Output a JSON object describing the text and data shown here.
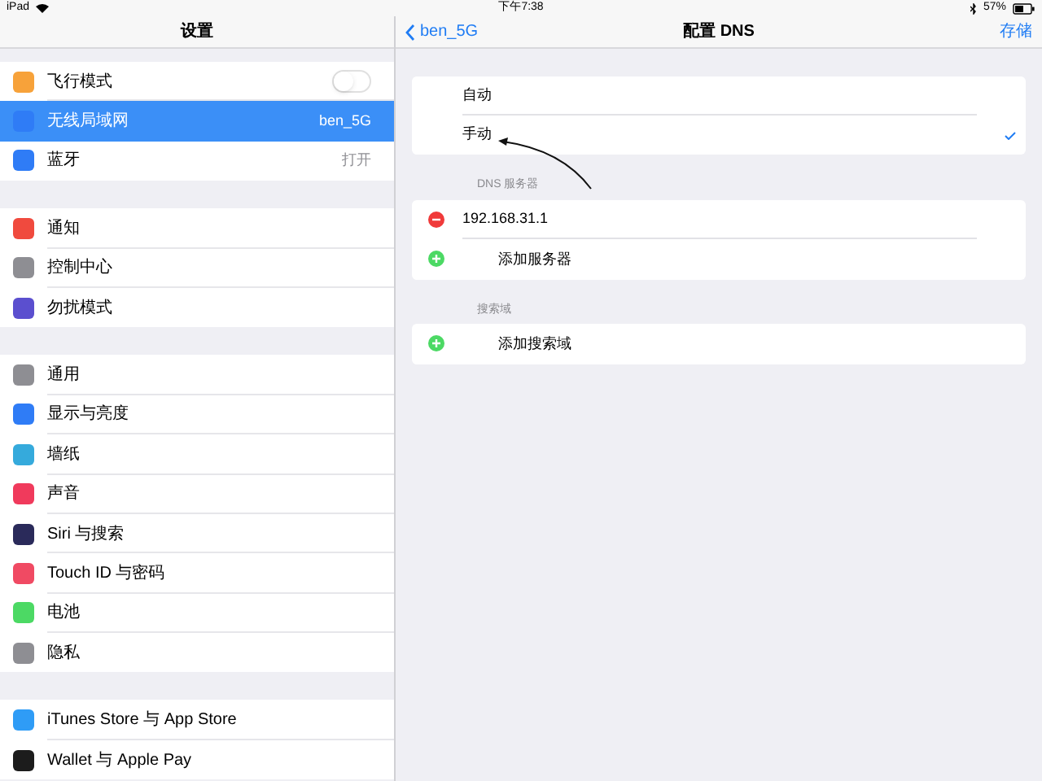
{
  "status_bar": {
    "device": "iPad",
    "time": "下午7:38",
    "battery": "57%"
  },
  "sidebar": {
    "title": "设置",
    "groups": [
      [
        {
          "label": "飞行模式",
          "color": "#f7a23a",
          "selected": false,
          "kind": "toggle",
          "on": false
        },
        {
          "label": "无线局域网",
          "color": "#2f7cf6",
          "selected": true,
          "kind": "value",
          "value": "ben_5G"
        },
        {
          "label": "蓝牙",
          "color": "#2f7cf6",
          "selected": false,
          "kind": "value",
          "value": "打开"
        }
      ],
      [
        {
          "label": "通知",
          "color": "#f04a3e",
          "selected": false,
          "kind": "plain"
        },
        {
          "label": "控制中心",
          "color": "#8e8e93",
          "selected": false,
          "kind": "plain"
        },
        {
          "label": "勿扰模式",
          "color": "#5b4fcf",
          "selected": false,
          "kind": "plain"
        }
      ],
      [
        {
          "label": "通用",
          "color": "#8e8e93",
          "selected": false,
          "kind": "plain"
        },
        {
          "label": "显示与亮度",
          "color": "#2f7cf6",
          "selected": false,
          "kind": "plain"
        },
        {
          "label": "墙纸",
          "color": "#35aadc",
          "selected": false,
          "kind": "plain"
        },
        {
          "label": "声音",
          "color": "#f03a5c",
          "selected": false,
          "kind": "plain"
        },
        {
          "label": "Siri 与搜索",
          "color": "#2a2a5a",
          "selected": false,
          "kind": "plain"
        },
        {
          "label": "Touch ID 与密码",
          "color": "#f04a63",
          "selected": false,
          "kind": "plain"
        },
        {
          "label": "电池",
          "color": "#4cd964",
          "selected": false,
          "kind": "plain"
        },
        {
          "label": "隐私",
          "color": "#8e8e93",
          "selected": false,
          "kind": "plain"
        }
      ],
      [
        {
          "label": "iTunes Store 与 App Store",
          "color": "#2f9cf6",
          "selected": false,
          "kind": "plain"
        },
        {
          "label": "Wallet 与 Apple Pay",
          "color": "#1c1c1c",
          "selected": false,
          "kind": "plain"
        }
      ]
    ]
  },
  "detail": {
    "back": "ben_5G",
    "title": "配置 DNS",
    "save": "存储",
    "modes": [
      {
        "label": "自动",
        "selected": false
      },
      {
        "label": "手动",
        "selected": true
      }
    ],
    "sections": [
      {
        "header": "DNS 服务器",
        "rows": [
          {
            "kind": "remove",
            "label": "192.168.31.1"
          },
          {
            "kind": "add",
            "label": "添加服务器"
          }
        ]
      },
      {
        "header": "搜索域",
        "rows": [
          {
            "kind": "add",
            "label": "添加搜索域"
          }
        ]
      }
    ]
  }
}
